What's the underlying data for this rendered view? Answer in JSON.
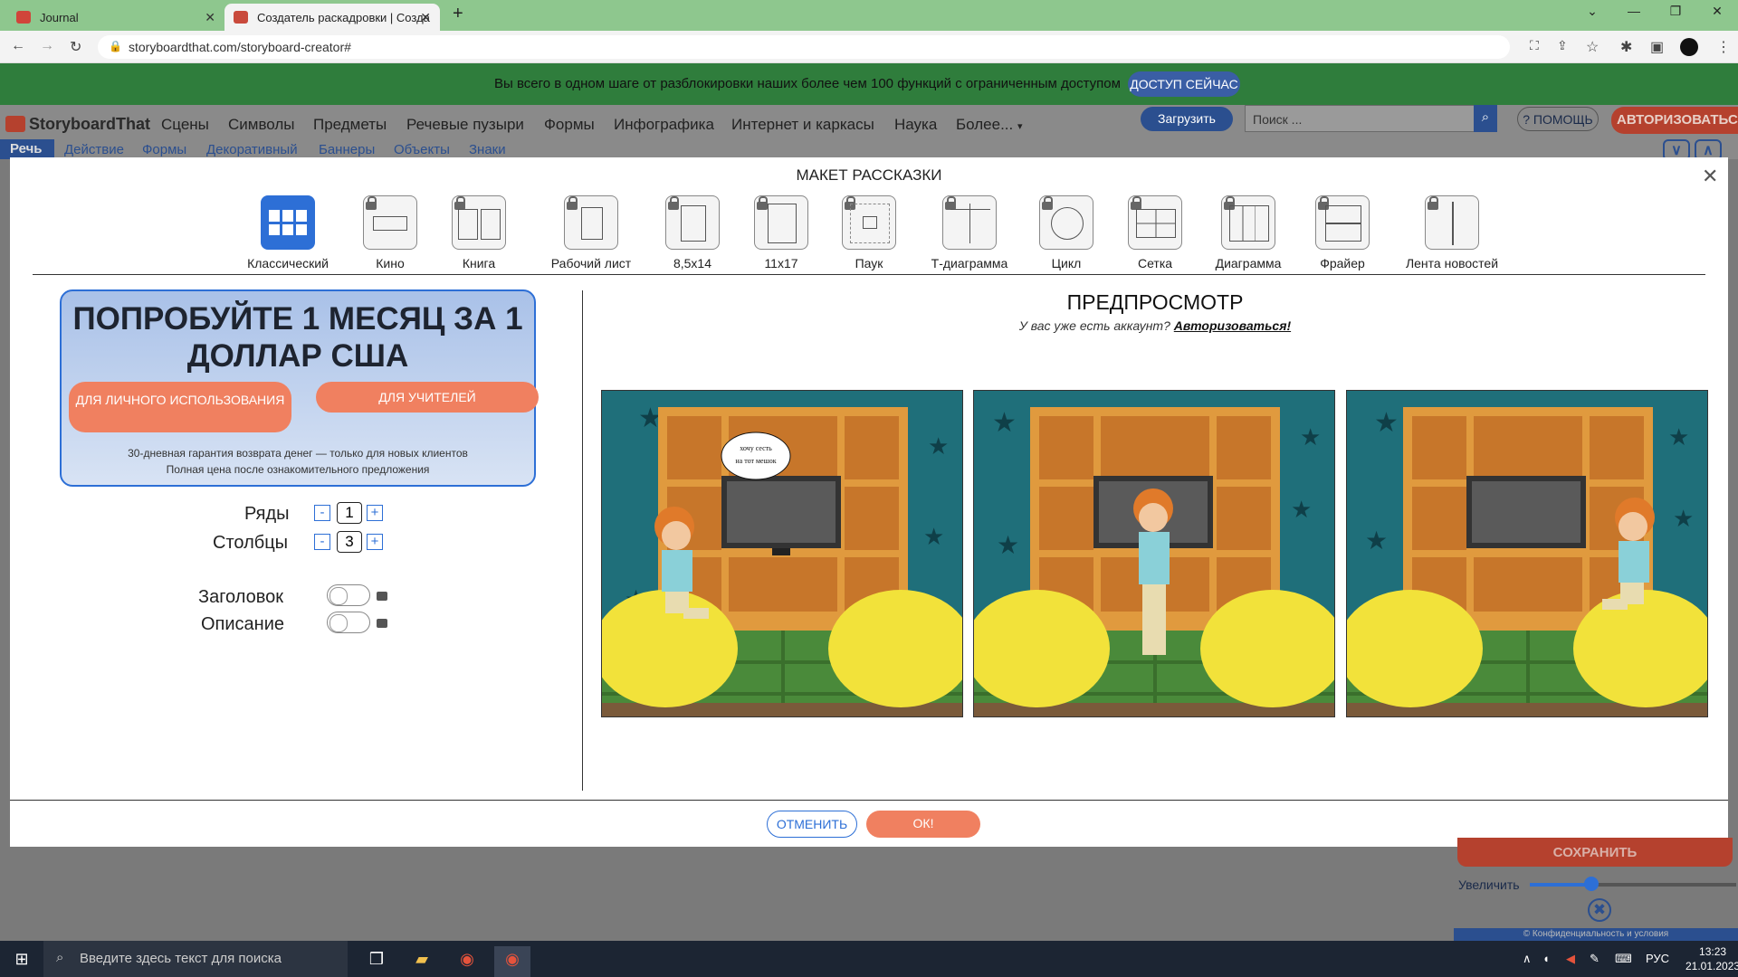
{
  "browser": {
    "tabs": [
      {
        "label": "Journal",
        "close": "✕"
      },
      {
        "label": "Создатель раскадровки | Созда",
        "close": "✕"
      }
    ],
    "new_tab": "+",
    "url": "storyboardthat.com/storyboard-creator#"
  },
  "promo": {
    "text": "Вы всего в одном шаге от разблокировки наших более чем 100 функций с ограниченным доступом",
    "button": "ДОСТУП СЕЙЧАС"
  },
  "app": {
    "logo": "StoryboardThat",
    "menu": [
      "Сцены",
      "Символы",
      "Предметы",
      "Речевые пузыри",
      "Формы",
      "Инфографика",
      "Интернет и каркасы",
      "Наука",
      "Более..."
    ],
    "load": "Загрузить",
    "search_placeholder": "Поиск ...",
    "help": "? ПОМОЩЬ",
    "login": "АВТОРИЗОВАТЬСЯ",
    "subnav_active": "Речь",
    "subnav": [
      "Действие",
      "Формы",
      "Декоративный",
      "Баннеры",
      "Объекты",
      "Знаки"
    ]
  },
  "modal": {
    "title": "МАКЕТ РАССКАЗКИ",
    "layouts": [
      "Классический",
      "Кино",
      "Книга",
      "Рабочий лист",
      "8,5x14",
      "11x17",
      "Паук",
      "Т-диаграмма",
      "Цикл",
      "Сетка",
      "Диаграмма",
      "Фрайер",
      "Лента новостей"
    ],
    "offer": {
      "headline": "ПОПРОБУЙТЕ 1 МЕСЯЦ ЗА 1 ДОЛЛАР США",
      "btn_personal": "ДЛЯ ЛИЧНОГО ИСПОЛЬЗОВАНИЯ",
      "btn_teachers": "ДЛЯ УЧИТЕЛЕЙ",
      "fine1": "30-дневная гарантия возврата денег — только для новых клиентов",
      "fine2": "Полная цена после ознакомительного предложения"
    },
    "rows_label": "Ряды",
    "rows_value": "1",
    "cols_label": "Столбцы",
    "cols_value": "3",
    "minus": "-",
    "plus": "+",
    "header_label": "Заголовок",
    "desc_label": "Описание",
    "preview_title": "ПРЕДПРОСМОТР",
    "preview_sub": "У вас уже есть аккаунт?",
    "preview_link": "Авторизоваться!",
    "speech": "хочу сесть на тот мешок",
    "cancel": "ОТМЕНИТЬ",
    "ok": "ОК!"
  },
  "sidebar": {
    "save": "СОХРАНИТЬ",
    "zoom_label": "Увеличить",
    "zoom_level": 0.3,
    "footer": "© Конфиденциальность и условия"
  },
  "taskbar": {
    "search_placeholder": "Введите здесь текст для поиска",
    "lang": "РУС",
    "time": "13:23",
    "date": "21.01.2023"
  },
  "colors": {
    "accent": "#2d6fd6",
    "cta": "#f08060",
    "scene_wall": "#1f6f7a",
    "beanbag": "#f2e23a"
  }
}
